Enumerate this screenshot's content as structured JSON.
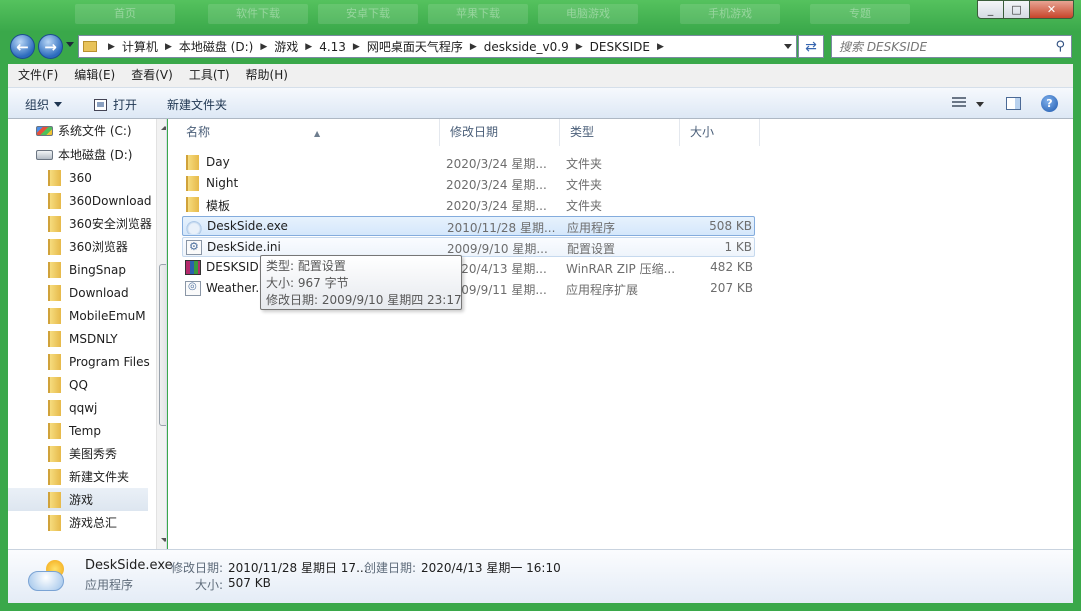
{
  "window": {
    "background_tabs": [
      "首页",
      "软件下载",
      "安卓下载",
      "苹果下载",
      "电脑游戏",
      "手机游戏",
      "专题"
    ],
    "caption": {
      "minimize": "_",
      "maximize": "□",
      "close": "✕"
    }
  },
  "address_bar": {
    "breadcrumbs": [
      "计算机",
      "本地磁盘 (D:)",
      "游戏",
      "4.13",
      "网吧桌面天气程序",
      "deskside_v0.9",
      "DESKSIDE"
    ],
    "search_placeholder": "搜索 DESKSIDE"
  },
  "menu": [
    "文件(F)",
    "编辑(E)",
    "查看(V)",
    "工具(T)",
    "帮助(H)"
  ],
  "toolbar": {
    "organize": "组织",
    "open": "打开",
    "new_folder": "新建文件夹"
  },
  "nav_pane": {
    "drives": [
      {
        "label": "系统文件 (C:)",
        "icon": "windows-drive-icon"
      },
      {
        "label": "本地磁盘 (D:)",
        "icon": "drive-icon"
      }
    ],
    "folders": [
      "360",
      "360Download",
      "360安全浏览器",
      "360浏览器",
      "BingSnap",
      "Download",
      "MobileEmuM",
      "MSDNLY",
      "Program Files",
      "QQ",
      "qqwj",
      "Temp",
      "美图秀秀",
      "新建文件夹",
      "游戏",
      "游戏总汇"
    ],
    "selected": "游戏"
  },
  "columns": {
    "name": "名称",
    "date": "修改日期",
    "type": "类型",
    "size": "大小"
  },
  "files": [
    {
      "name": "Day",
      "date": "2020/3/24 星期...",
      "type": "文件夹",
      "size": "",
      "icon": "folder-icon"
    },
    {
      "name": "Night",
      "date": "2020/3/24 星期...",
      "type": "文件夹",
      "size": "",
      "icon": "folder-icon"
    },
    {
      "name": "模板",
      "date": "2020/3/24 星期...",
      "type": "文件夹",
      "size": "",
      "icon": "folder-icon"
    },
    {
      "name": "DeskSide.exe",
      "date": "2010/11/28 星期...",
      "type": "应用程序",
      "size": "508 KB",
      "icon": "exe-icon"
    },
    {
      "name": "DeskSide.ini",
      "date": "2009/9/10 星期...",
      "type": "配置设置",
      "size": "1 KB",
      "icon": "ini-icon"
    },
    {
      "name": "DESKSIDE",
      "date": "2020/4/13 星期...",
      "type": "WinRAR ZIP 压缩...",
      "size": "482 KB",
      "icon": "zip-icon"
    },
    {
      "name": "Weather.c",
      "date": "2009/9/11 星期...",
      "type": "应用程序扩展",
      "size": "207 KB",
      "icon": "dll-icon"
    }
  ],
  "tooltip": {
    "type": "类型: 配置设置",
    "size": "大小: 967 字节",
    "modified": "修改日期: 2009/9/10 星期四 23:17"
  },
  "details": {
    "name": "DeskSide.exe",
    "type": "应用程序",
    "modified_label": "修改日期:",
    "modified_value": "2010/11/28 星期日 17...",
    "created_label": "创建日期:",
    "created_value": "2020/4/13 星期一 16:10",
    "size_label": "大小:",
    "size_value": "507 KB"
  }
}
